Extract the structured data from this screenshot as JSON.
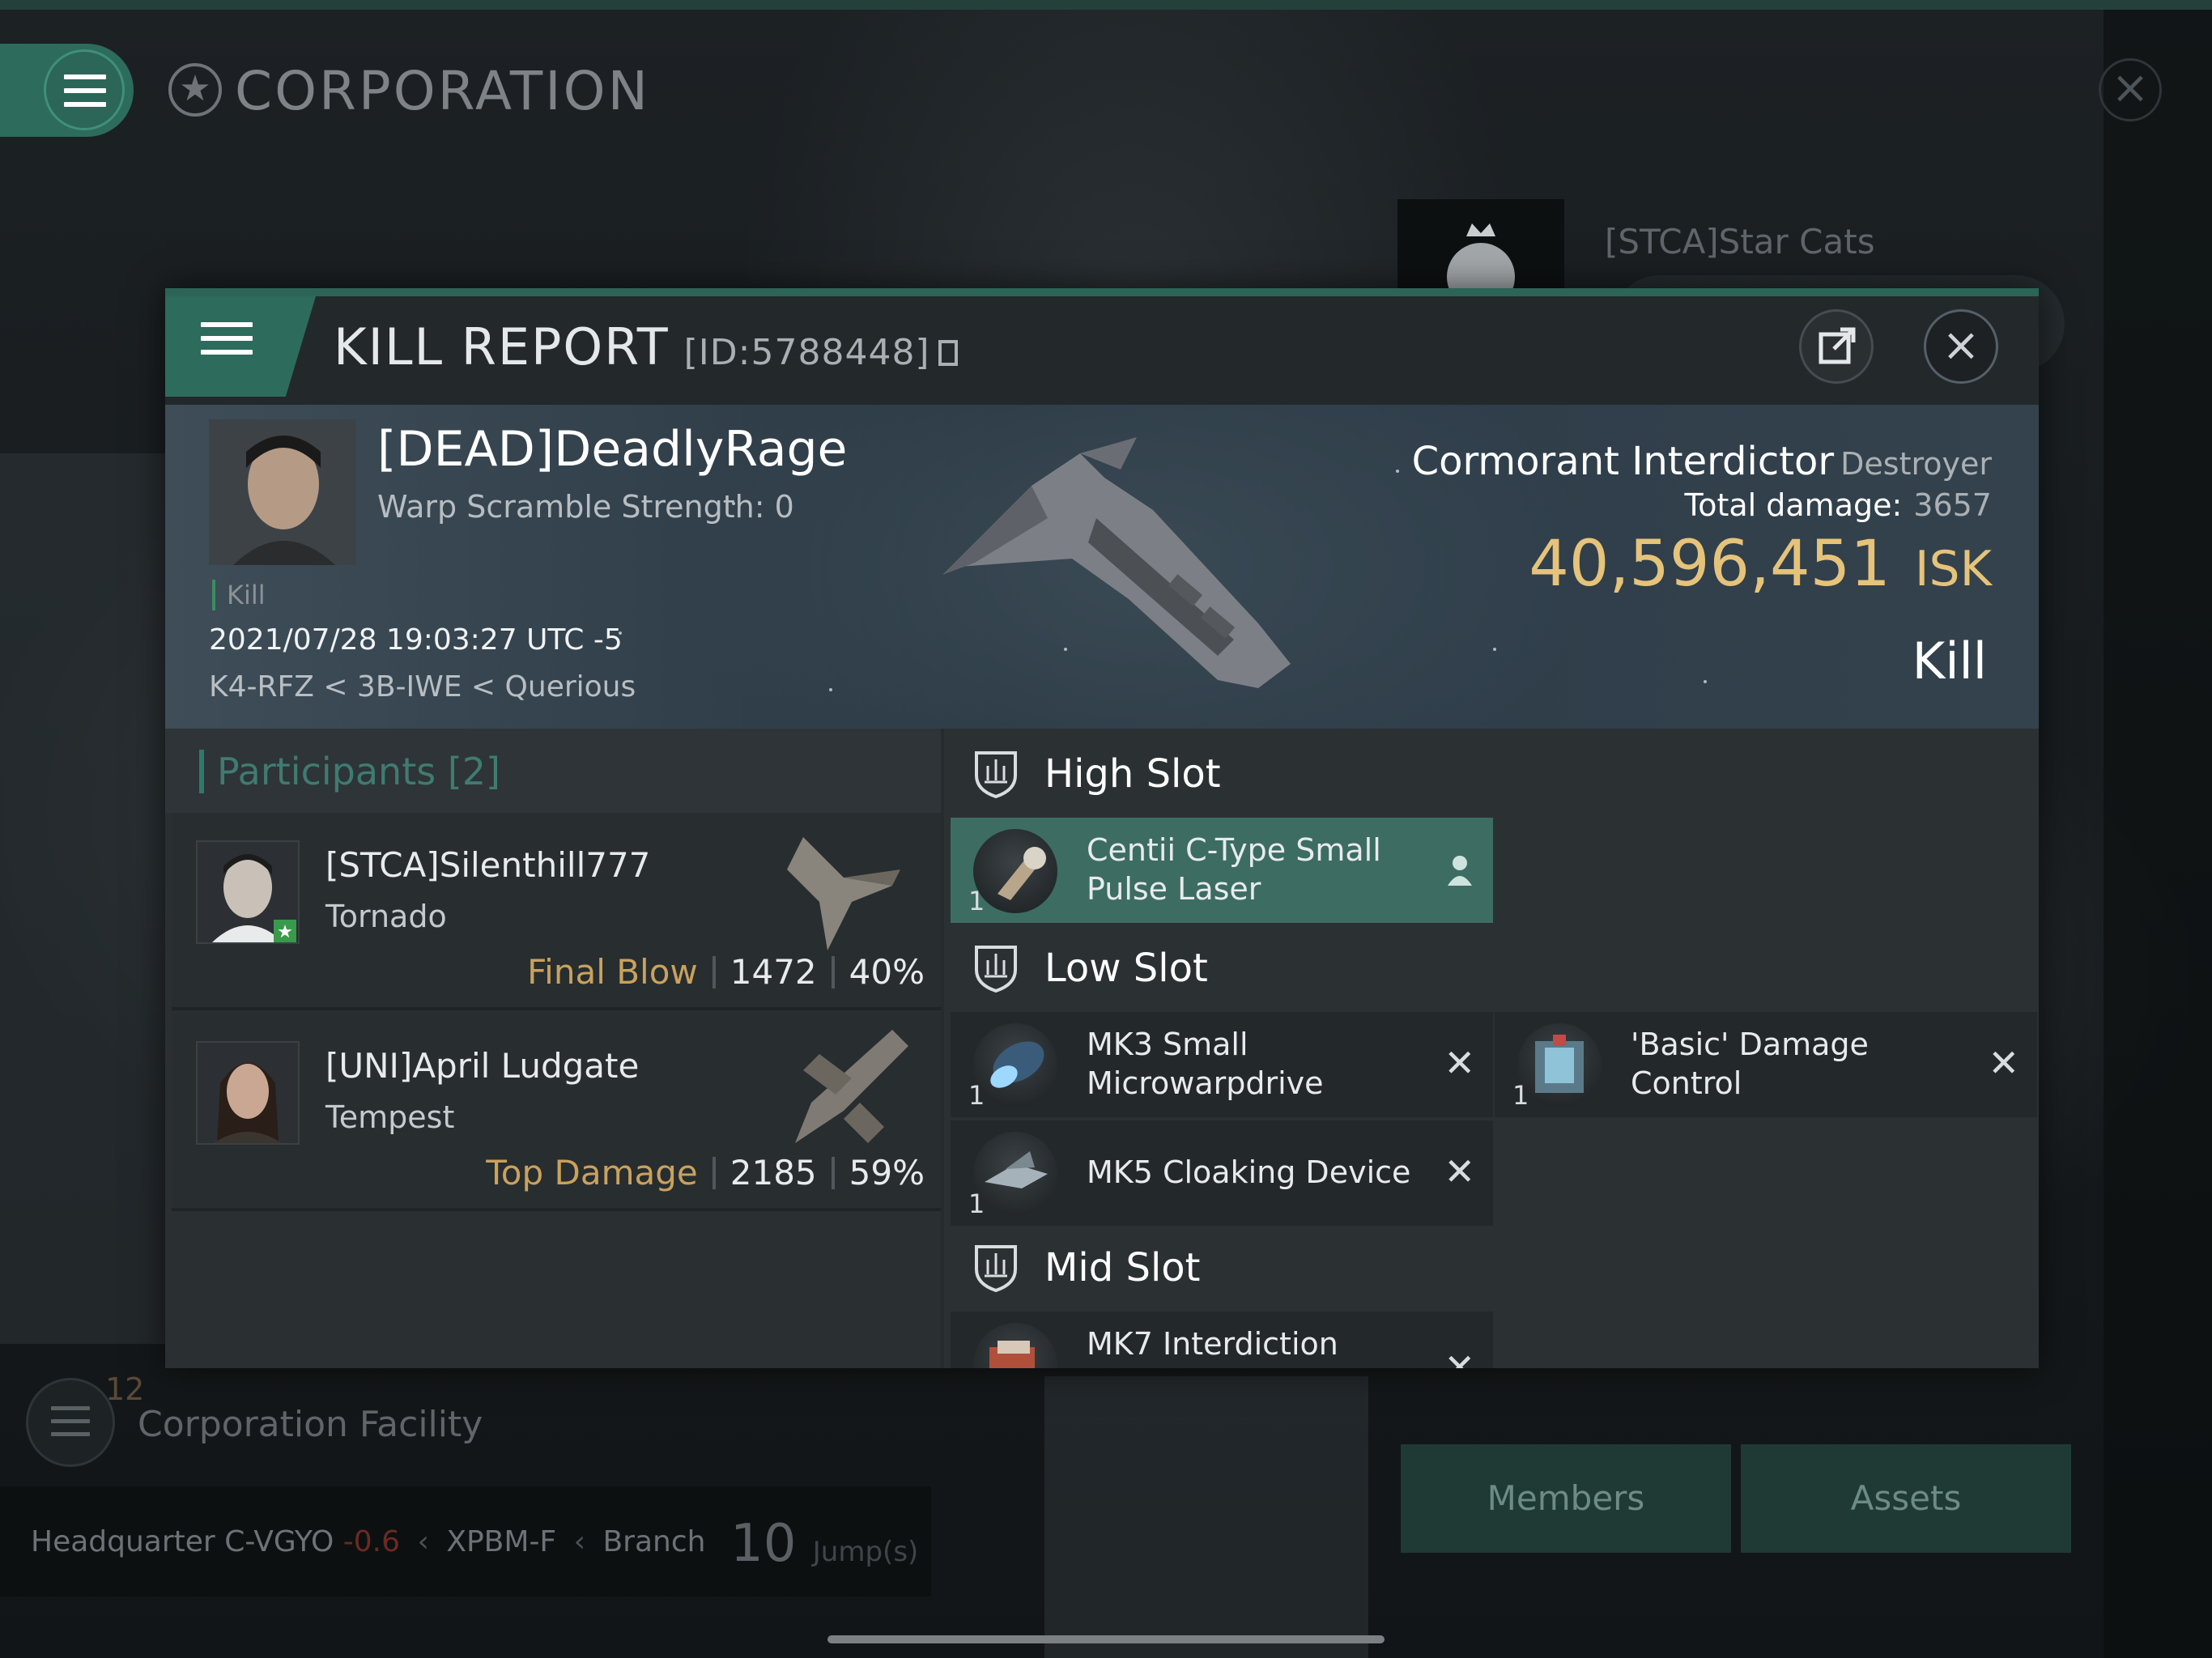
{
  "background": {
    "corporation_title": "CORPORATION",
    "stca_name": "[STCA]Star Cats",
    "facility_count": "12",
    "facility_label": "Corporation Facility",
    "hq_label": "Headquarter",
    "hq_system": "C-VGYO",
    "hq_security": "-0.6",
    "hq_region": "XPBM-F",
    "hq_branch": "Branch",
    "jumps_value": "10",
    "jumps_unit": "Jump(s)",
    "members_label": "Members",
    "assets_label": "Assets"
  },
  "kill_report": {
    "title": "KILL REPORT",
    "id": "[ID:5788448]",
    "victim": {
      "name": "[DEAD]DeadlyRage",
      "warp_scramble": "Warp Scramble Strength: 0",
      "kill_label": "Kill",
      "timestamp": "2021/07/28 19:03:27 UTC -5",
      "location": "K4-RFZ < 3B-IWE < Querious"
    },
    "ship": {
      "name": "Cormorant Interdictor",
      "class": "Destroyer",
      "total_damage_label": "Total damage:",
      "total_damage_value": "3657",
      "isk_value": "40,596,451",
      "isk_unit": "ISK",
      "result": "Kill"
    },
    "participants_title": "Participants [2]",
    "participants": [
      {
        "name": "[STCA]Silenthill777",
        "ship": "Tornado",
        "tag": "Final Blow",
        "damage": "1472",
        "percent": "40%"
      },
      {
        "name": "[UNI]April Ludgate",
        "ship": "Tempest",
        "tag": "Top Damage",
        "damage": "2185",
        "percent": "59%"
      }
    ],
    "slots": {
      "high_label": "High Slot",
      "low_label": "Low Slot",
      "mid_label": "Mid Slot",
      "high": [
        {
          "name": "Centii C-Type Small Pulse Laser",
          "qty": "1"
        }
      ],
      "low": [
        {
          "name": "MK3 Small Microwarpdrive",
          "qty": "1"
        },
        {
          "name": "'Basic' Damage Control",
          "qty": "1"
        },
        {
          "name": "MK5 Cloaking Device",
          "qty": "1"
        }
      ],
      "mid": [
        {
          "name": "MK7 Interdiction"
        }
      ]
    }
  },
  "colors": {
    "accent": "#2d6b5d",
    "isk_gold": "#e6c37a",
    "participant_tag_gold": "#c9a25d",
    "selected_module": "#3d6c62"
  }
}
